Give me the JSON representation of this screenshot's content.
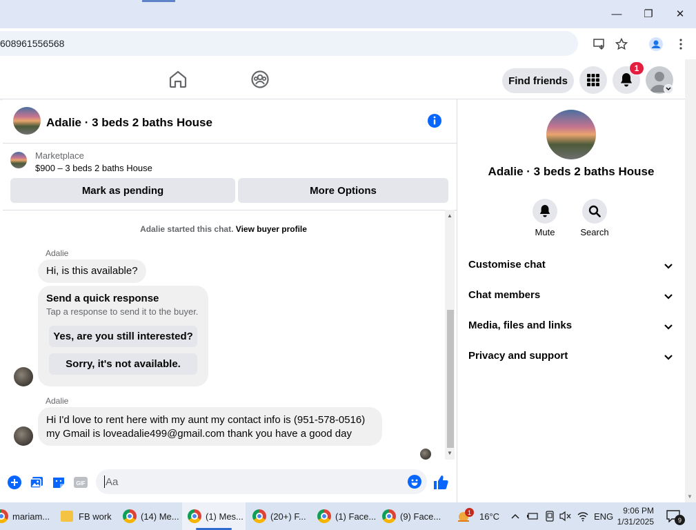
{
  "browser": {
    "url": "608961556568",
    "window_controls": {
      "minimize": "—",
      "restore": "❐",
      "close": "✕"
    }
  },
  "header": {
    "find_friends": "Find friends",
    "notification_count": "1"
  },
  "chat": {
    "title": "Adalie · 3 beds 2 baths House",
    "marketplace": {
      "label": "Marketplace",
      "listing": "$900 – 3 beds 2 baths House",
      "mark_pending": "Mark as pending",
      "more_options": "More Options"
    },
    "system_text": "Adalie started this chat.",
    "view_profile": "View buyer profile",
    "messages": [
      {
        "sender": "Adalie",
        "text": "Hi, is this available?"
      },
      {
        "sender": "Adalie",
        "line1": "Hi I'd love to rent here with my aunt my contact info is (951-578-0516)",
        "line2": "my Gmail is loveadalie499@gmail.com thank you have a good day"
      }
    ],
    "quick_response": {
      "title": "Send a quick response",
      "subtitle": "Tap a response to send it to the buyer.",
      "options": [
        "Yes, are you still interested?",
        "Sorry, it's not available."
      ]
    },
    "composer": {
      "placeholder": "Aa"
    }
  },
  "info_panel": {
    "name": "Adalie · 3 beds 2 baths House",
    "actions": [
      "Mute",
      "Search"
    ],
    "sections": [
      "Customise chat",
      "Chat members",
      "Media, files and links",
      "Privacy and support"
    ]
  },
  "taskbar": {
    "items": [
      "mariam...",
      "FB work",
      "(14) Me...",
      "(1) Mes...",
      "(20+) F...",
      "(1) Face...",
      "(9) Face..."
    ],
    "weather": "16°C",
    "weather_badge": "1",
    "language": "ENG",
    "time": "9:06 PM",
    "date": "1/31/2025",
    "notification_count": "9"
  },
  "colors": {
    "accent": "#0866ff",
    "badge": "#e41e3f",
    "bubble": "#f0f0f0"
  }
}
